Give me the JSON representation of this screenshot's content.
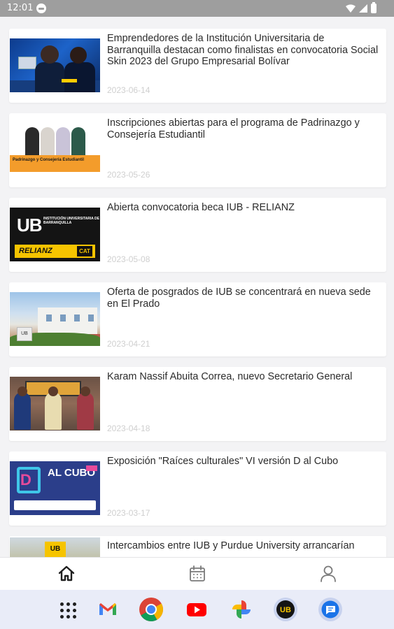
{
  "status_bar": {
    "time": "12:01",
    "icons": [
      "notification-icon",
      "wifi-icon",
      "cellular-icon",
      "battery-icon"
    ]
  },
  "news": [
    {
      "title": "Emprendedores de la Institución Universitaria de Barranquilla destacan como finalistas en convocatoria Social Skin 2023 del Grupo Empresarial Bolívar",
      "date": "2023-06-14"
    },
    {
      "title": "Inscripciones abiertas para el programa de Padrinazgo y Consejería Estudiantil",
      "date": "2023-05-26",
      "thumb_text": "Padrinazgo y Consejería Estudiantil"
    },
    {
      "title": "Abierta convocatoria beca IUB - RELIANZ",
      "date": "2023-05-08",
      "thumb_logo": "UB",
      "thumb_logo_sub": "INSTITUCIÓN UNIVERSITARIA DE BARRANQUILLA",
      "thumb_brand": "RELIANZ",
      "thumb_brand2": "CAT"
    },
    {
      "title": "Oferta de posgrados de IUB se concentrará en nueva sede en El Prado",
      "date": "2023-04-21",
      "thumb_sign": "UB"
    },
    {
      "title": "Karam Nassif Abuita Correa, nuevo Secretario General",
      "date": "2023-04-18"
    },
    {
      "title": "Exposición \"Raíces culturales\" VI versión D al Cubo",
      "date": "2023-03-17",
      "thumb_letter": "D",
      "thumb_text": "AL CUBO"
    },
    {
      "title": "Intercambios entre IUB y Purdue University arrancarían",
      "date": "",
      "thumb_sign": "UB"
    }
  ],
  "bottom_nav": {
    "items": [
      "home-icon",
      "calendar-icon",
      "profile-icon"
    ],
    "active": "home-icon"
  },
  "dock": {
    "apps": [
      "app-drawer",
      "gmail",
      "chrome",
      "youtube",
      "google-photos",
      "iub-app",
      "messages"
    ]
  },
  "colors": {
    "background": "#f3f3f5",
    "card": "#ffffff",
    "title_text": "#2c2c2c",
    "date_text": "#cfcfcf",
    "status_bar": "#9e9e9e",
    "dock": "#e9ecf8"
  }
}
